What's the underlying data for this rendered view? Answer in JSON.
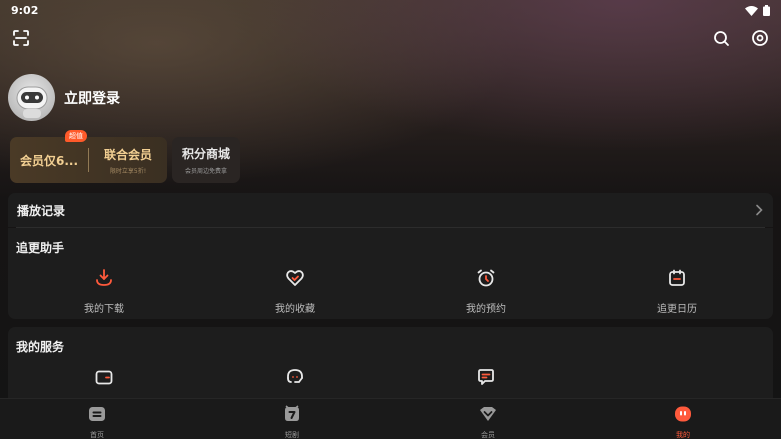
{
  "status_bar": {
    "time": "9:02"
  },
  "profile": {
    "login_label": "立即登录"
  },
  "vip": {
    "badge": "超值",
    "left_label": "会员仅6...",
    "right_title": "联合会员",
    "right_subtitle": "限时立享5折!"
  },
  "points": {
    "title": "积分商城",
    "subtitle": "会员周边免费拿"
  },
  "history": {
    "title": "播放记录"
  },
  "follow": {
    "title": "追更助手",
    "items": [
      {
        "label": "我的下载",
        "icon": "download-icon"
      },
      {
        "label": "我的收藏",
        "icon": "favorite-heart-icon"
      },
      {
        "label": "我的预约",
        "icon": "alarm-clock-icon"
      },
      {
        "label": "追更日历",
        "icon": "calendar-icon"
      }
    ]
  },
  "services": {
    "title": "我的服务",
    "items": [
      {
        "icon": "wallet-icon"
      },
      {
        "icon": "customer-service-icon"
      },
      {
        "icon": "feedback-message-icon"
      }
    ]
  },
  "tabs": [
    {
      "label": "首页",
      "icon": "home-tv-icon",
      "active": false
    },
    {
      "label": "短剧",
      "icon": "short-drama-icon",
      "active": false
    },
    {
      "label": "会员",
      "icon": "vip-diamond-icon",
      "active": false
    },
    {
      "label": "我的",
      "icon": "mine-face-icon",
      "active": true
    }
  ],
  "colors": {
    "accent": "#ff5a3c",
    "gold": "#f2cf92",
    "panel": "#1d1d1d"
  }
}
